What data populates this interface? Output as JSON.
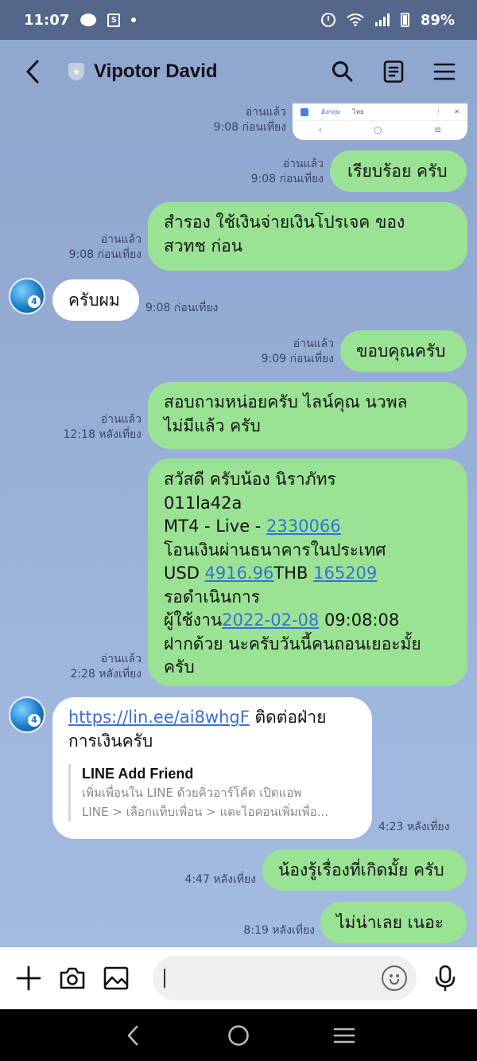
{
  "status": {
    "time": "11:07",
    "bag_glyph": "S",
    "battery": "89%"
  },
  "header": {
    "title": "Vipotor David",
    "icons": [
      "back-arrow-icon",
      "shield-icon",
      "search-icon",
      "notes-icon",
      "menu-icon"
    ]
  },
  "thumbnail": {
    "tab1": "อังกฤษ",
    "tab2": "ไทย"
  },
  "messages": [
    {
      "read": "อ่านแล้ว",
      "time": "9:08 ก่อนเที่ยง"
    },
    {
      "read": "อ่านแล้ว",
      "time": "9:08 ก่อนเที่ยง",
      "text": "เรียบร้อย ครับ"
    },
    {
      "read": "อ่านแล้ว",
      "time": "9:08 ก่อนเที่ยง",
      "line1": "สำรอง ใช้เงินจ่ายเงินโปรเจค ของ",
      "line2": "สวทช ก่อน"
    },
    {
      "time": "9:08 ก่อนเที่ยง",
      "text": "ครับผม"
    },
    {
      "read": "อ่านแล้ว",
      "time": "9:09 ก่อนเที่ยง",
      "text": "ขอบคุณครับ"
    },
    {
      "read": "อ่านแล้ว",
      "time": "12:18 หลังเที่ยง",
      "line1": "สอบถามหน่อยครับ ไลน์คุณ นวพล",
      "line2": "ไม่มีแล้ว ครับ"
    },
    {
      "read": "อ่านแล้ว",
      "time": "2:28 หลังเที่ยง",
      "l1": "สวัสดี ครับน้อง นิราภัทร",
      "l2": "011la42a",
      "l3_pre": "MT4 - Live - ",
      "l3_link": "2330066",
      "l4": "โอนเงินผ่านธนาคารในประเทศ",
      "l5_a": "USD ",
      "l5_link1": "4916.96",
      "l5_b": "THB ",
      "l5_link2": "165209",
      "l6": "รอดำเนินการ",
      "l7_pre": "ผู้ใช้งาน",
      "l7_link": "2022-02-08",
      "l7_post": " 09:08:08",
      "l8": "ฝากด้วย นะครับวันนี้คนถอนเยอะมั้ย",
      "l9": "ครับ"
    },
    {
      "time": "4:23 หลังเที่ยง",
      "link": "https://lin.ee/ai8whgF",
      "after_link": " ติดต่อฝ่าย",
      "line2": "การเงินครับ",
      "card_title": "LINE Add Friend",
      "card_desc1": "เพิ่มเพื่อนใน LINE ด้วยคิวอาร์โค้ด เปิดแอพ",
      "card_desc2": "LINE > เลือกแท็บเพื่อน > แตะไอคอนเพิ่มเพื่อ..."
    },
    {
      "time": "4:47 หลังเที่ยง",
      "text": "น้องรู้เรื่องที่เกิดมั้ย ครับ"
    },
    {
      "time": "8:19 หลังเที่ยง",
      "text": "ไม่น่าเลย เนอะ"
    }
  ],
  "input": {
    "value": "",
    "icons": [
      "plus-icon",
      "camera-icon",
      "image-icon",
      "emoji-icon",
      "mic-icon"
    ]
  },
  "nav": {
    "icons": [
      "nav-back-icon",
      "nav-home-icon",
      "nav-recents-icon"
    ]
  },
  "colors": {
    "outgoing_bubble": "#9be394",
    "incoming_bubble": "#ffffff",
    "link": "#3a6fd6",
    "status_bar": "#53678a"
  }
}
